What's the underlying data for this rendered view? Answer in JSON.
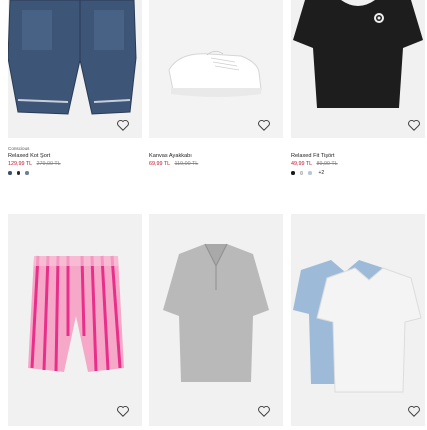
{
  "products": [
    {
      "id": "card-1",
      "tag": "Conscious",
      "name": "Relaxed Kot Şort",
      "price": "129,99 TL",
      "old_price": "279,00 TL",
      "swatches": [
        "#3a4f6e",
        "#2a2a2a",
        "#6b7f99"
      ],
      "more": "",
      "image_icon": "denim-shorts-image"
    },
    {
      "id": "card-2",
      "tag": "",
      "name": "Kanvas Ayakkabı",
      "price": "69,99 TL",
      "old_price": "119,00 TL",
      "swatches": [
        "#f2f2f2",
        "#c9c9c9"
      ],
      "more": "",
      "image_icon": "white-sneaker-image"
    },
    {
      "id": "card-3",
      "tag": "",
      "name": "Relaxed Fit Tişört",
      "price": "49,99 TL",
      "old_price": "89,99 TL",
      "swatches": [
        "#1a1a1a",
        "#e6e6e6",
        "#b7c7d8"
      ],
      "more": "+2",
      "image_icon": "black-tshirt-image"
    },
    {
      "id": "card-4",
      "tag": "",
      "name": "",
      "price": "",
      "old_price": "",
      "swatches": [],
      "more": "",
      "image_icon": "pink-striped-shorts-image"
    },
    {
      "id": "card-5",
      "tag": "",
      "name": "",
      "price": "",
      "old_price": "",
      "swatches": [],
      "more": "",
      "image_icon": "grey-polo-shirt-image"
    },
    {
      "id": "card-6",
      "tag": "",
      "name": "",
      "price": "",
      "old_price": "",
      "swatches": [],
      "more": "",
      "image_icon": "blue-white-tshirts-image"
    }
  ],
  "colors": {
    "sale_price": "#c8102e",
    "old_price": "#8a8a8a",
    "image_bg": "#f4f4f4"
  }
}
